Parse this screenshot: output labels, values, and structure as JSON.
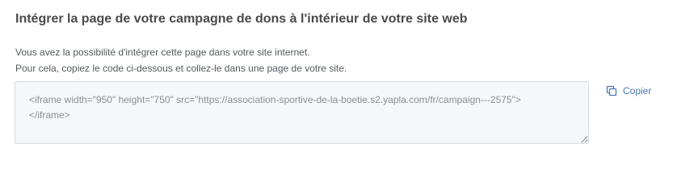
{
  "section": {
    "title": "Intégrer la page de votre campagne de dons à l'intérieur de votre site web",
    "description_line1": "Vous avez la possibilité d'intégrer cette page dans votre site internet.",
    "description_line2": "Pour cela, copiez le code ci-dessous et collez-le dans une page de votre site."
  },
  "embed": {
    "code": "<iframe width=\"950\" height=\"750\" src=\"https://association-sportive-de-la-boetie.s2.yapla.com/fr/campaign---2575\">\n</iframe>"
  },
  "copy": {
    "label": "Copier",
    "icon": "copy-icon"
  },
  "colors": {
    "accent": "#4a77b4",
    "code_background": "#f5f7fa",
    "code_border": "#d6dde6",
    "title_text": "#4a4a4a"
  }
}
